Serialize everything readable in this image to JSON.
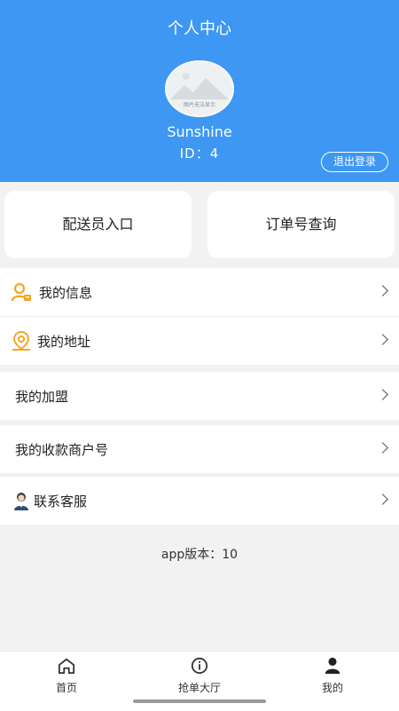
{
  "header": {
    "title": "个人中心",
    "avatar_caption": "图片无法显示",
    "username": "Sunshine",
    "user_id": "ID：4",
    "logout_label": "退出登录"
  },
  "quick_actions": {
    "courier_entry": "配送员入口",
    "order_lookup": "订单号查询"
  },
  "menu": {
    "my_info": "我的信息",
    "my_address": "我的地址",
    "my_franchise": "我的加盟",
    "my_merchant_account": "我的收款商户号",
    "customer_service": "联系客服"
  },
  "version_text": "app版本：10",
  "tabbar": {
    "home": "首页",
    "order_hall": "抢单大厅",
    "mine": "我的"
  },
  "colors": {
    "header_bg": "#3d97f3",
    "icon_orange": "#f5a623",
    "background": "#f2f2f2"
  },
  "icons": {
    "my_info": "user-badge-icon",
    "my_address": "location-pin-icon",
    "customer_service": "agent-icon",
    "home": "home-icon",
    "order_hall": "info-circle-icon",
    "mine": "person-icon"
  }
}
